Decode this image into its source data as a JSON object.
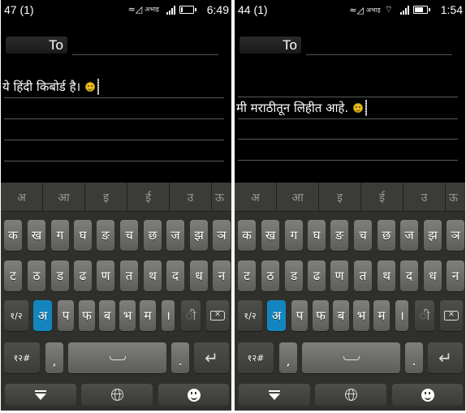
{
  "screens": [
    {
      "id": "left",
      "status": {
        "message_count": "47 (1)",
        "operator": "अभाइ",
        "signal_bars": 4,
        "battery_percent": 15,
        "wifi": false,
        "time": "6:49"
      },
      "to_label": "To",
      "message_text": "ये हिंदी किबोर्ड है।",
      "text_line": 1
    },
    {
      "id": "right",
      "status": {
        "message_count": "44 (1)",
        "operator": "अभाइ",
        "signal_bars": 4,
        "battery_percent": 80,
        "wifi": true,
        "time": "1:54"
      },
      "to_label": "To",
      "message_text": "मी मराठीतून लिहीत आहे.",
      "text_line": 2
    }
  ],
  "keyboard": {
    "candidates": [
      "अ",
      "आ",
      "इ",
      "ई",
      "उ",
      "ऊ"
    ],
    "row1": [
      "क",
      "ख",
      "ग",
      "घ",
      "ङ",
      "च",
      "छ",
      "ज",
      "झ",
      "ञ"
    ],
    "row2": [
      "ट",
      "ठ",
      "ड",
      "ढ",
      "ण",
      "त",
      "थ",
      "द",
      "ध",
      "न"
    ],
    "row3": {
      "page_key": "१/२",
      "vowel_key": "अ",
      "letters": [
        "प",
        "फ",
        "ब",
        "भ",
        "म"
      ],
      "danda": "।",
      "matra": "ी",
      "backspace_icon": "backspace-icon"
    },
    "row4": {
      "numbers_key": "१२#",
      "comma": ",",
      "space_icon": "space-icon",
      "period": ".",
      "enter_icon": "enter-icon"
    },
    "bottom": [
      "hide-keyboard-icon",
      "globe-icon",
      "emoji-icon"
    ],
    "accent_color": "#1386c0"
  }
}
